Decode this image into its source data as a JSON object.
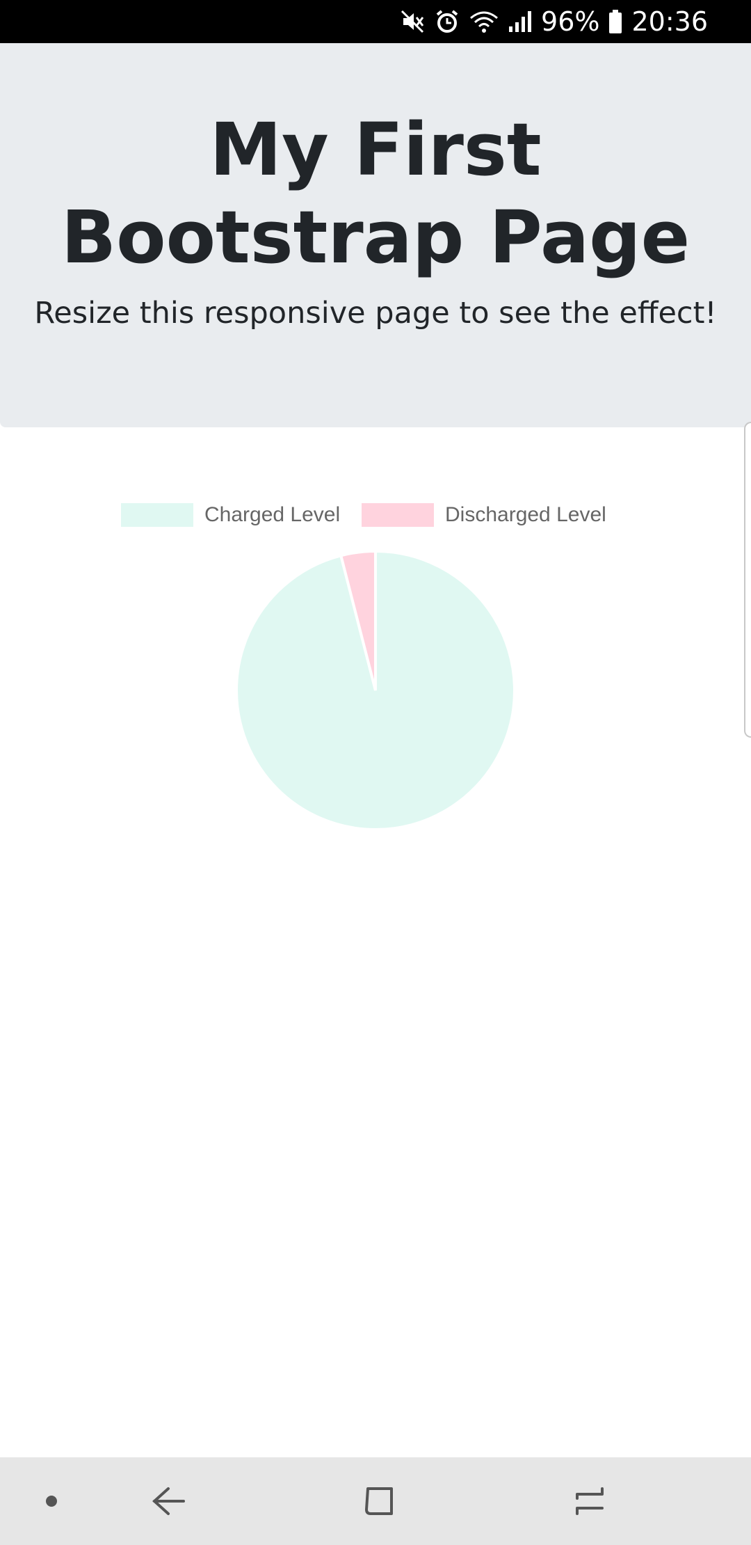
{
  "status_bar": {
    "battery_percent": "96%",
    "time": "20:36",
    "icons": [
      "mute-icon",
      "alarm-icon",
      "wifi-icon",
      "signal-icon",
      "battery-icon"
    ]
  },
  "jumbotron": {
    "title": "My First Bootstrap Page",
    "subtitle": "Resize this responsive page to see the effect!"
  },
  "chart_data": {
    "type": "pie",
    "labels": [
      "Charged Level",
      "Discharged Level"
    ],
    "values": [
      96,
      4
    ],
    "colors": [
      "#e0f8f2",
      "#ffd3de"
    ],
    "border_color": "#ffffff",
    "legend": "top",
    "start_angle": "top, clockwise"
  },
  "nav_bar": {
    "buttons": [
      "dot-icon",
      "back-icon",
      "home-icon",
      "recents-icon"
    ]
  }
}
